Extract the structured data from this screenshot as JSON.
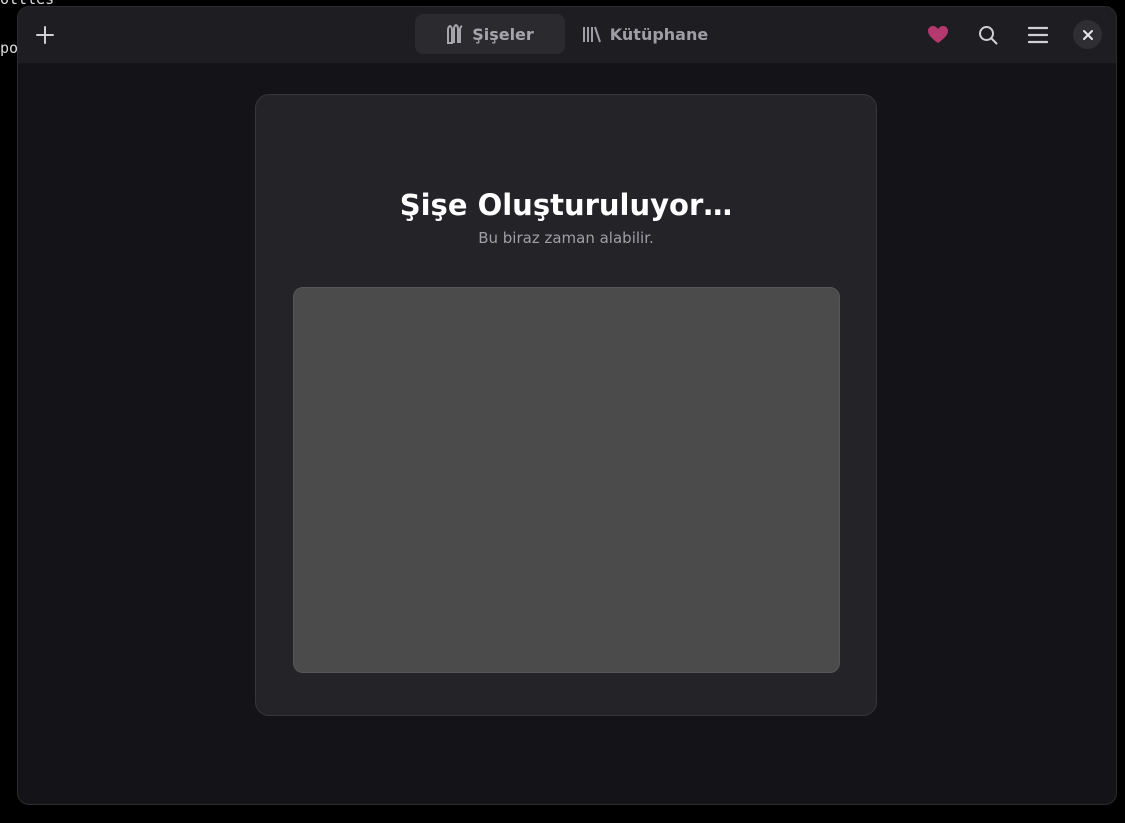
{
  "background_terminal": {
    "line1": "ottles",
    "line2": "po"
  },
  "header": {
    "tabs": [
      {
        "label": "Şişeler",
        "icon": "bottles-icon",
        "active": true
      },
      {
        "label": "Kütüphane",
        "icon": "library-icon",
        "active": false
      }
    ],
    "buttons": {
      "add": "plus-icon",
      "donate": "heart-icon",
      "search": "search-icon",
      "menu": "hamburger-menu-icon",
      "close": "close-icon"
    }
  },
  "dialog": {
    "title": "Şişe Oluşturuluyor…",
    "subtitle": "Bu biraz zaman alabilir."
  },
  "colors": {
    "heart": "#b5386f",
    "window_bg": "#141418",
    "card_bg": "#232328",
    "output_bg": "#4b4b4b"
  }
}
